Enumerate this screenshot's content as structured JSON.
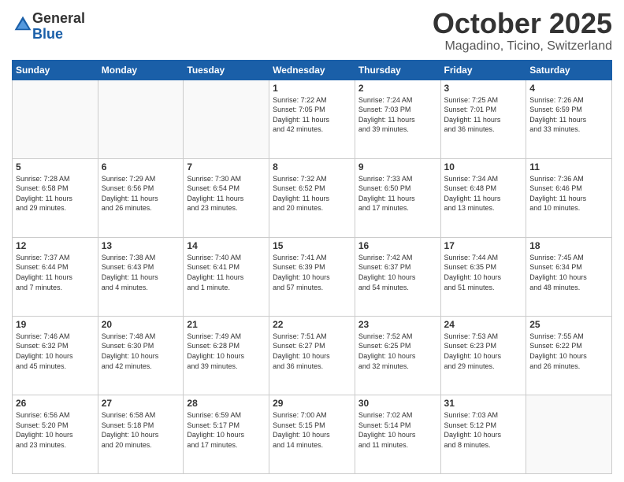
{
  "header": {
    "logo_line1": "General",
    "logo_line2": "Blue",
    "month": "October 2025",
    "location": "Magadino, Ticino, Switzerland"
  },
  "weekdays": [
    "Sunday",
    "Monday",
    "Tuesday",
    "Wednesday",
    "Thursday",
    "Friday",
    "Saturday"
  ],
  "weeks": [
    [
      {
        "day": "",
        "info": ""
      },
      {
        "day": "",
        "info": ""
      },
      {
        "day": "",
        "info": ""
      },
      {
        "day": "1",
        "info": "Sunrise: 7:22 AM\nSunset: 7:05 PM\nDaylight: 11 hours\nand 42 minutes."
      },
      {
        "day": "2",
        "info": "Sunrise: 7:24 AM\nSunset: 7:03 PM\nDaylight: 11 hours\nand 39 minutes."
      },
      {
        "day": "3",
        "info": "Sunrise: 7:25 AM\nSunset: 7:01 PM\nDaylight: 11 hours\nand 36 minutes."
      },
      {
        "day": "4",
        "info": "Sunrise: 7:26 AM\nSunset: 6:59 PM\nDaylight: 11 hours\nand 33 minutes."
      }
    ],
    [
      {
        "day": "5",
        "info": "Sunrise: 7:28 AM\nSunset: 6:58 PM\nDaylight: 11 hours\nand 29 minutes."
      },
      {
        "day": "6",
        "info": "Sunrise: 7:29 AM\nSunset: 6:56 PM\nDaylight: 11 hours\nand 26 minutes."
      },
      {
        "day": "7",
        "info": "Sunrise: 7:30 AM\nSunset: 6:54 PM\nDaylight: 11 hours\nand 23 minutes."
      },
      {
        "day": "8",
        "info": "Sunrise: 7:32 AM\nSunset: 6:52 PM\nDaylight: 11 hours\nand 20 minutes."
      },
      {
        "day": "9",
        "info": "Sunrise: 7:33 AM\nSunset: 6:50 PM\nDaylight: 11 hours\nand 17 minutes."
      },
      {
        "day": "10",
        "info": "Sunrise: 7:34 AM\nSunset: 6:48 PM\nDaylight: 11 hours\nand 13 minutes."
      },
      {
        "day": "11",
        "info": "Sunrise: 7:36 AM\nSunset: 6:46 PM\nDaylight: 11 hours\nand 10 minutes."
      }
    ],
    [
      {
        "day": "12",
        "info": "Sunrise: 7:37 AM\nSunset: 6:44 PM\nDaylight: 11 hours\nand 7 minutes."
      },
      {
        "day": "13",
        "info": "Sunrise: 7:38 AM\nSunset: 6:43 PM\nDaylight: 11 hours\nand 4 minutes."
      },
      {
        "day": "14",
        "info": "Sunrise: 7:40 AM\nSunset: 6:41 PM\nDaylight: 11 hours\nand 1 minute."
      },
      {
        "day": "15",
        "info": "Sunrise: 7:41 AM\nSunset: 6:39 PM\nDaylight: 10 hours\nand 57 minutes."
      },
      {
        "day": "16",
        "info": "Sunrise: 7:42 AM\nSunset: 6:37 PM\nDaylight: 10 hours\nand 54 minutes."
      },
      {
        "day": "17",
        "info": "Sunrise: 7:44 AM\nSunset: 6:35 PM\nDaylight: 10 hours\nand 51 minutes."
      },
      {
        "day": "18",
        "info": "Sunrise: 7:45 AM\nSunset: 6:34 PM\nDaylight: 10 hours\nand 48 minutes."
      }
    ],
    [
      {
        "day": "19",
        "info": "Sunrise: 7:46 AM\nSunset: 6:32 PM\nDaylight: 10 hours\nand 45 minutes."
      },
      {
        "day": "20",
        "info": "Sunrise: 7:48 AM\nSunset: 6:30 PM\nDaylight: 10 hours\nand 42 minutes."
      },
      {
        "day": "21",
        "info": "Sunrise: 7:49 AM\nSunset: 6:28 PM\nDaylight: 10 hours\nand 39 minutes."
      },
      {
        "day": "22",
        "info": "Sunrise: 7:51 AM\nSunset: 6:27 PM\nDaylight: 10 hours\nand 36 minutes."
      },
      {
        "day": "23",
        "info": "Sunrise: 7:52 AM\nSunset: 6:25 PM\nDaylight: 10 hours\nand 32 minutes."
      },
      {
        "day": "24",
        "info": "Sunrise: 7:53 AM\nSunset: 6:23 PM\nDaylight: 10 hours\nand 29 minutes."
      },
      {
        "day": "25",
        "info": "Sunrise: 7:55 AM\nSunset: 6:22 PM\nDaylight: 10 hours\nand 26 minutes."
      }
    ],
    [
      {
        "day": "26",
        "info": "Sunrise: 6:56 AM\nSunset: 5:20 PM\nDaylight: 10 hours\nand 23 minutes."
      },
      {
        "day": "27",
        "info": "Sunrise: 6:58 AM\nSunset: 5:18 PM\nDaylight: 10 hours\nand 20 minutes."
      },
      {
        "day": "28",
        "info": "Sunrise: 6:59 AM\nSunset: 5:17 PM\nDaylight: 10 hours\nand 17 minutes."
      },
      {
        "day": "29",
        "info": "Sunrise: 7:00 AM\nSunset: 5:15 PM\nDaylight: 10 hours\nand 14 minutes."
      },
      {
        "day": "30",
        "info": "Sunrise: 7:02 AM\nSunset: 5:14 PM\nDaylight: 10 hours\nand 11 minutes."
      },
      {
        "day": "31",
        "info": "Sunrise: 7:03 AM\nSunset: 5:12 PM\nDaylight: 10 hours\nand 8 minutes."
      },
      {
        "day": "",
        "info": ""
      }
    ]
  ]
}
